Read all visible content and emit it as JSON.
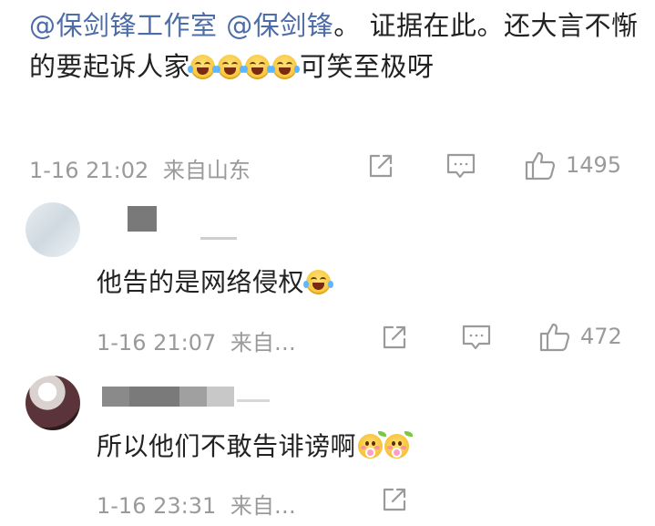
{
  "main_comment": {
    "mention1": "@保剑锋工作室",
    "mention2": "@保剑锋",
    "text_part1": "。 证据在此。还大言不惭的要起诉人家",
    "emoji_count": 4,
    "text_part2": "可笑至极呀",
    "time": "1-16 21:02",
    "location": "来自山东",
    "likes": "1495"
  },
  "replies": [
    {
      "text": "他告的是网络侵权",
      "time": "1-16 21:07",
      "location": "来自…",
      "likes": "472"
    },
    {
      "text": "所以他们不敢告诽谤啊",
      "time": "1-16 23:31",
      "location": "来自…"
    }
  ],
  "icons": {
    "share": "share-icon",
    "comment": "comment-icon",
    "like": "thumbs-up-icon",
    "laugh": "laugh-cry-emoji",
    "flower": "flower-face-emoji"
  },
  "colors": {
    "mention": "#4c6da8",
    "meta": "#9a9a9a",
    "text": "#222222"
  }
}
